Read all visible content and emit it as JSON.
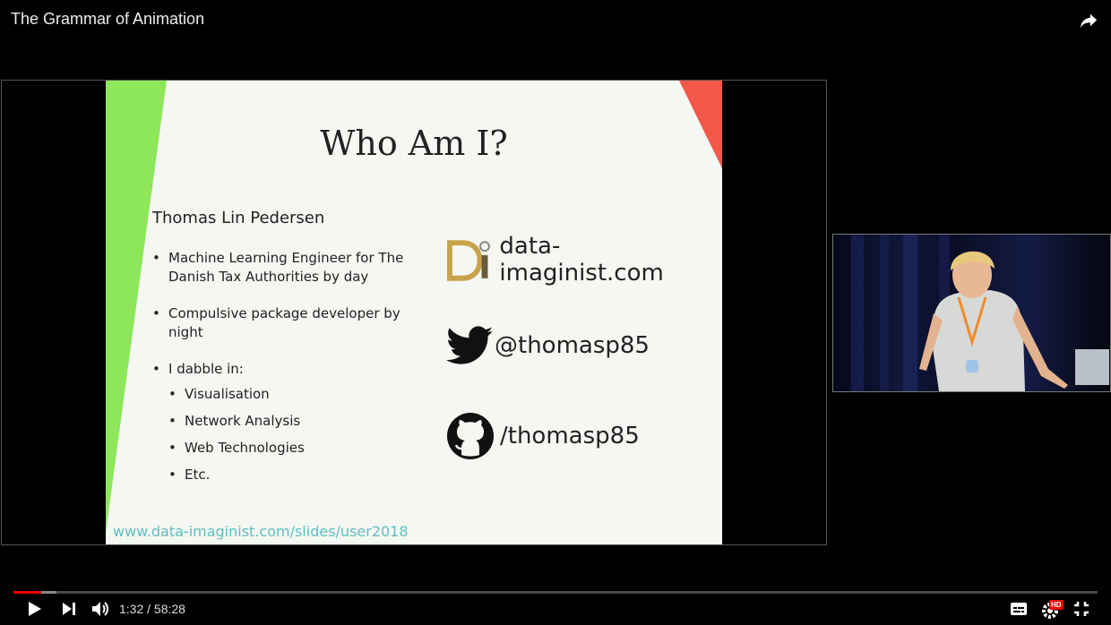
{
  "video": {
    "title": "The Grammar of Animation"
  },
  "slide": {
    "heading": "Who Am I?",
    "speaker": "Thomas Lin Pedersen",
    "bullets": {
      "b1": "Machine Learning Engineer for The Danish Tax Authorities by day",
      "b2": "Compulsive package developer by night",
      "b3": "I dabble in:"
    },
    "dabble": [
      "Visualisation",
      "Network Analysis",
      "Web Technologies",
      "Etc."
    ],
    "contacts": {
      "website": "data-imaginist.com",
      "twitter": "@thomasp85",
      "github": "/thomasp85"
    },
    "url": "www.data-imaginist.com/slides/user2018",
    "accent_green": "#8ee65a",
    "accent_red": "#f2574a"
  },
  "player": {
    "current_time": "1:32",
    "duration": "58:28",
    "time_display": "1:32 / 58:28",
    "progress_fraction": 0.026,
    "buffered_fraction": 0.04,
    "quality_badge": "HD",
    "icons": [
      "play-icon",
      "next-icon",
      "volume-icon",
      "subtitles-icon",
      "settings-icon",
      "exit-fullscreen-icon",
      "share-icon"
    ]
  }
}
